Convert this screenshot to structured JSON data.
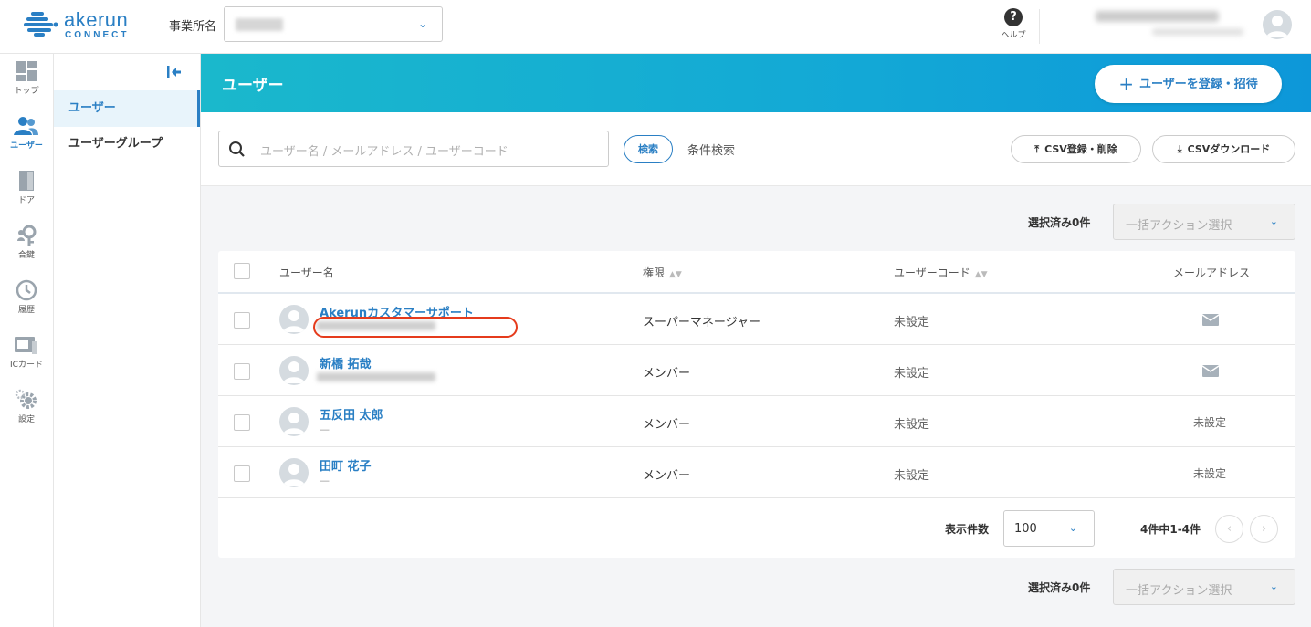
{
  "brand": {
    "name": "akerun",
    "sub": "CONNECT",
    "color": "#2a7fc4"
  },
  "header": {
    "office_label": "事業所名",
    "help_label": "ヘルプ"
  },
  "nav": [
    {
      "label": "トップ",
      "icon": "dashboard-icon"
    },
    {
      "label": "ユーザー",
      "icon": "users-icon",
      "active": true
    },
    {
      "label": "ドア",
      "icon": "door-icon"
    },
    {
      "label": "合鍵",
      "icon": "key-icon"
    },
    {
      "label": "履歴",
      "icon": "history-icon"
    },
    {
      "label": "ICカード",
      "icon": "ic-card-icon"
    },
    {
      "label": "設定",
      "icon": "gear-icon"
    }
  ],
  "subnav": [
    {
      "label": "ユーザー",
      "active": true
    },
    {
      "label": "ユーザーグループ"
    }
  ],
  "banner": {
    "title": "ユーザー",
    "register_label": "ユーザーを登録・招待"
  },
  "search": {
    "placeholder": "ユーザー名 / メールアドレス / ユーザーコード",
    "button_label": "検索",
    "condition_label": "条件検索",
    "csv_register_label": "CSV登録・削除",
    "csv_download_label": "CSVダウンロード"
  },
  "bulk": {
    "selected_label": "選択済み0件",
    "action_placeholder": "一括アクション選択"
  },
  "table": {
    "columns": [
      "ユーザー名",
      "権限",
      "ユーザーコード",
      "メールアドレス"
    ],
    "rows": [
      {
        "name": "Akerunカスタマーサポート",
        "sub": "",
        "role": "スーパーマネージャー",
        "code": "未設定",
        "email": "",
        "has_email": true
      },
      {
        "name": "新橋 拓哉",
        "sub": "",
        "role": "メンバー",
        "code": "未設定",
        "email": "",
        "has_email": true
      },
      {
        "name": "五反田 太郎",
        "sub": "—",
        "role": "メンバー",
        "code": "未設定",
        "email": "未設定",
        "has_email": false
      },
      {
        "name": "田町 花子",
        "sub": "—",
        "role": "メンバー",
        "code": "未設定",
        "email": "未設定",
        "has_email": false
      }
    ]
  },
  "pager": {
    "per_page_label": "表示件数",
    "per_page_value": "100",
    "count_label": "4件中1-4件",
    "prev": "‹",
    "next": "›"
  },
  "colors": {
    "accent": "#2a7fc4",
    "banner_start": "#1ab8cc",
    "banner_end": "#0d97d9",
    "highlight": "#e53b1c"
  }
}
